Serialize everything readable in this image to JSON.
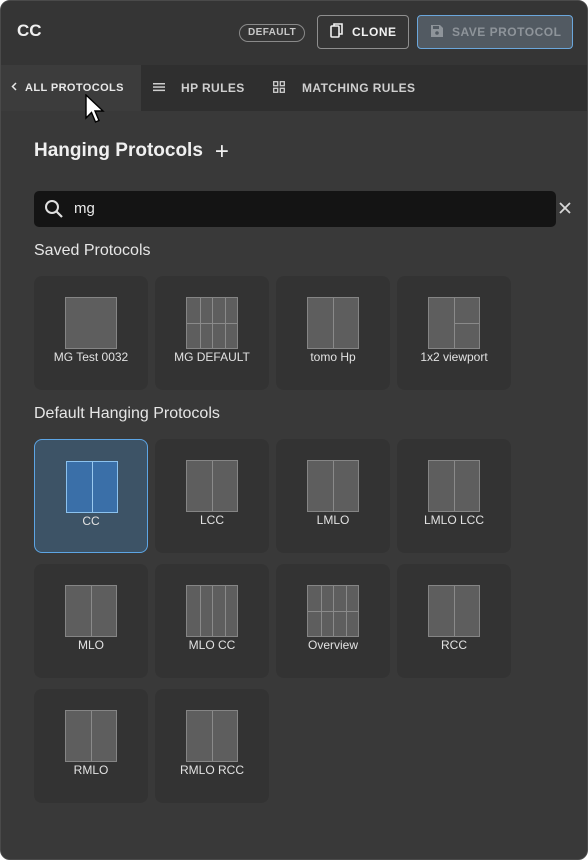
{
  "header": {
    "title": "CC",
    "badge": "DEFAULT",
    "clone_label": "CLONE",
    "save_label": "SAVE PROTOCOL"
  },
  "tabs": [
    {
      "label": "ALL PROTOCOLS",
      "icon": "chevron-left-icon",
      "active": true
    },
    {
      "label": "HP RULES",
      "icon": "menu-lines-icon"
    },
    {
      "label": "MATCHING RULES",
      "icon": "grid-icon"
    }
  ],
  "main": {
    "title": "Hanging Protocols",
    "search": {
      "value": "mg",
      "placeholder": ""
    },
    "saved_section": "Saved Protocols",
    "default_section": "Default Hanging Protocols"
  },
  "saved_protocols": [
    {
      "label": "MG Test 0032",
      "layout": "1x1"
    },
    {
      "label": "MG DEFAULT",
      "layout": "4x2"
    },
    {
      "label": "tomo Hp",
      "layout": "1x2"
    },
    {
      "label": "1x2 viewport",
      "layout": "1x2-right-split"
    }
  ],
  "default_protocols": [
    {
      "label": "CC",
      "layout": "1x2",
      "selected": true
    },
    {
      "label": "LCC",
      "layout": "1x2"
    },
    {
      "label": "LMLO",
      "layout": "1x2"
    },
    {
      "label": "LMLO LCC",
      "layout": "1x2"
    },
    {
      "label": "MLO",
      "layout": "1x2"
    },
    {
      "label": "MLO CC",
      "layout": "4x1"
    },
    {
      "label": "Overview",
      "layout": "4x2"
    },
    {
      "label": "RCC",
      "layout": "1x2"
    },
    {
      "label": "RMLO",
      "layout": "1x2"
    },
    {
      "label": "RMLO RCC",
      "layout": "1x2"
    }
  ],
  "colors": {
    "accent": "#5da5e4",
    "selected_card": "#3d5366",
    "panel": "#393939"
  }
}
